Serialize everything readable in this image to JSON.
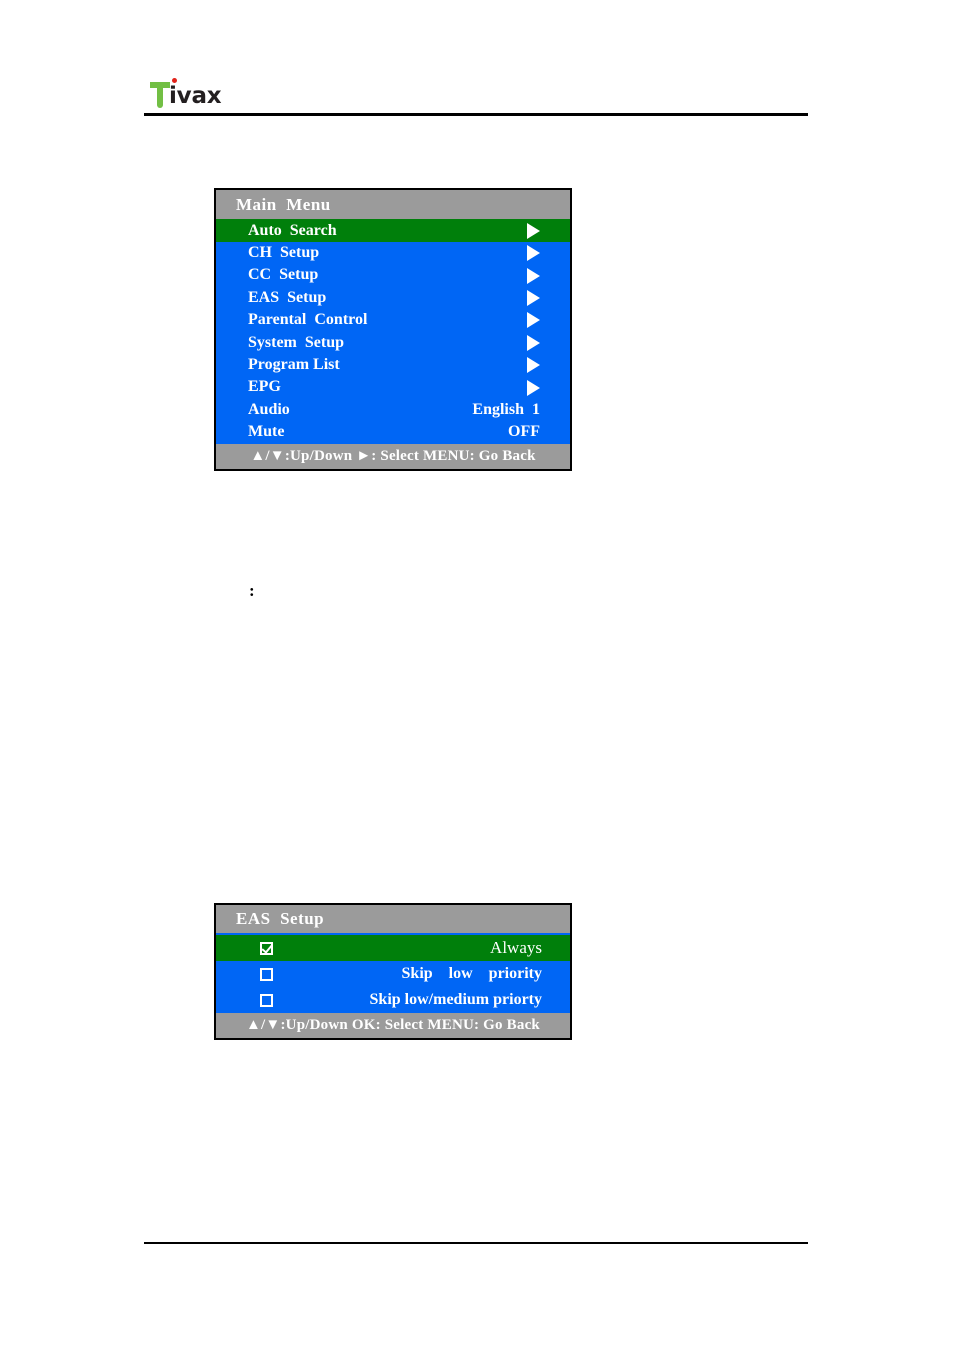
{
  "page": {
    "brand": {
      "logo_letter": "T",
      "logo_text": "ivax"
    },
    "stray_text": ":"
  },
  "main_menu": {
    "title": "Main  Menu",
    "items": [
      {
        "label": "Auto  Search",
        "value": "arrow",
        "selected": true
      },
      {
        "label": "CH  Setup",
        "value": "arrow",
        "selected": false
      },
      {
        "label": "CC  Setup",
        "value": "arrow",
        "selected": false
      },
      {
        "label": "EAS  Setup",
        "value": "arrow",
        "selected": false
      },
      {
        "label": "Parental  Control",
        "value": "arrow",
        "selected": false
      },
      {
        "label": "System  Setup",
        "value": "arrow",
        "selected": false
      },
      {
        "label": "Program List",
        "value": "arrow",
        "selected": false
      },
      {
        "label": "EPG",
        "value": "arrow",
        "selected": false
      },
      {
        "label": "Audio",
        "value": "English  1",
        "selected": false
      },
      {
        "label": "Mute",
        "value": "OFF",
        "selected": false
      }
    ],
    "footer": "▲/▼:Up/Down ►: Select MENU: Go Back"
  },
  "eas_menu": {
    "title": "EAS  Setup",
    "options": [
      {
        "label": "Always",
        "checked": true,
        "selected": true
      },
      {
        "label": "Skip    low    priority",
        "checked": false,
        "selected": false
      },
      {
        "label": "Skip low/medium priorty",
        "checked": false,
        "selected": false
      }
    ],
    "footer": "▲/▼:Up/Down OK: Select MENU: Go Back"
  },
  "colors": {
    "header_gray": "#9b9b9b",
    "menu_blue": "#0066f5",
    "selected_green": "#007f0b",
    "logo_green": "#72bf44",
    "logo_red": "#e2231a",
    "text_white": "#ffffff"
  }
}
